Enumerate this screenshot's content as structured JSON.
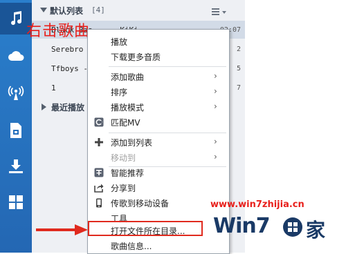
{
  "sidebar": {
    "items": [
      {
        "icon": "music-note-icon",
        "active": true
      },
      {
        "icon": "cloud-icon"
      },
      {
        "icon": "radio-signal-icon"
      },
      {
        "icon": "document-icon"
      },
      {
        "icon": "download-icon"
      },
      {
        "icon": "grid-apps-icon"
      }
    ]
  },
  "playlist": {
    "title": "默认列表",
    "count": "[4]",
    "songs": [
      {
        "name": "Black Bas... - KiKi",
        "duration": "02:07",
        "selected": true
      },
      {
        "name": "Serebro -",
        "duration": "2"
      },
      {
        "name": "Tfboys -",
        "duration": "5"
      },
      {
        "name": "1",
        "duration": "7"
      }
    ],
    "recent_title": "最近播放"
  },
  "overlay_text": "右击歌曲",
  "context_menu": {
    "items": [
      {
        "label": "播放"
      },
      {
        "label": "下载更多音质"
      },
      {
        "label": "添加歌曲",
        "submenu": true
      },
      {
        "label": "排序",
        "submenu": true
      },
      {
        "label": "播放模式",
        "submenu": true
      },
      {
        "label": "匹配MV",
        "icon": "mv-match-icon"
      },
      {
        "label": "添加到列表",
        "icon": "plus-icon",
        "submenu": true
      },
      {
        "label": "移动到",
        "submenu": true,
        "disabled": true
      },
      {
        "label": "智能推荐",
        "icon": "recommend-icon"
      },
      {
        "label": "分享到",
        "icon": "share-icon"
      },
      {
        "label": "传歌到移动设备",
        "icon": "mobile-device-icon"
      },
      {
        "label": "工具"
      },
      {
        "label": "打开文件所在目录...",
        "highlighted": true
      },
      {
        "label": "歌曲信息..."
      }
    ]
  },
  "watermark": {
    "url": "www.win7zhijia.cn",
    "brand": "Win7",
    "brand_suffix": "家"
  },
  "colors": {
    "sidebar": "#2470bd",
    "highlight_box": "#e02a1e",
    "overlay": "#e8201c"
  }
}
